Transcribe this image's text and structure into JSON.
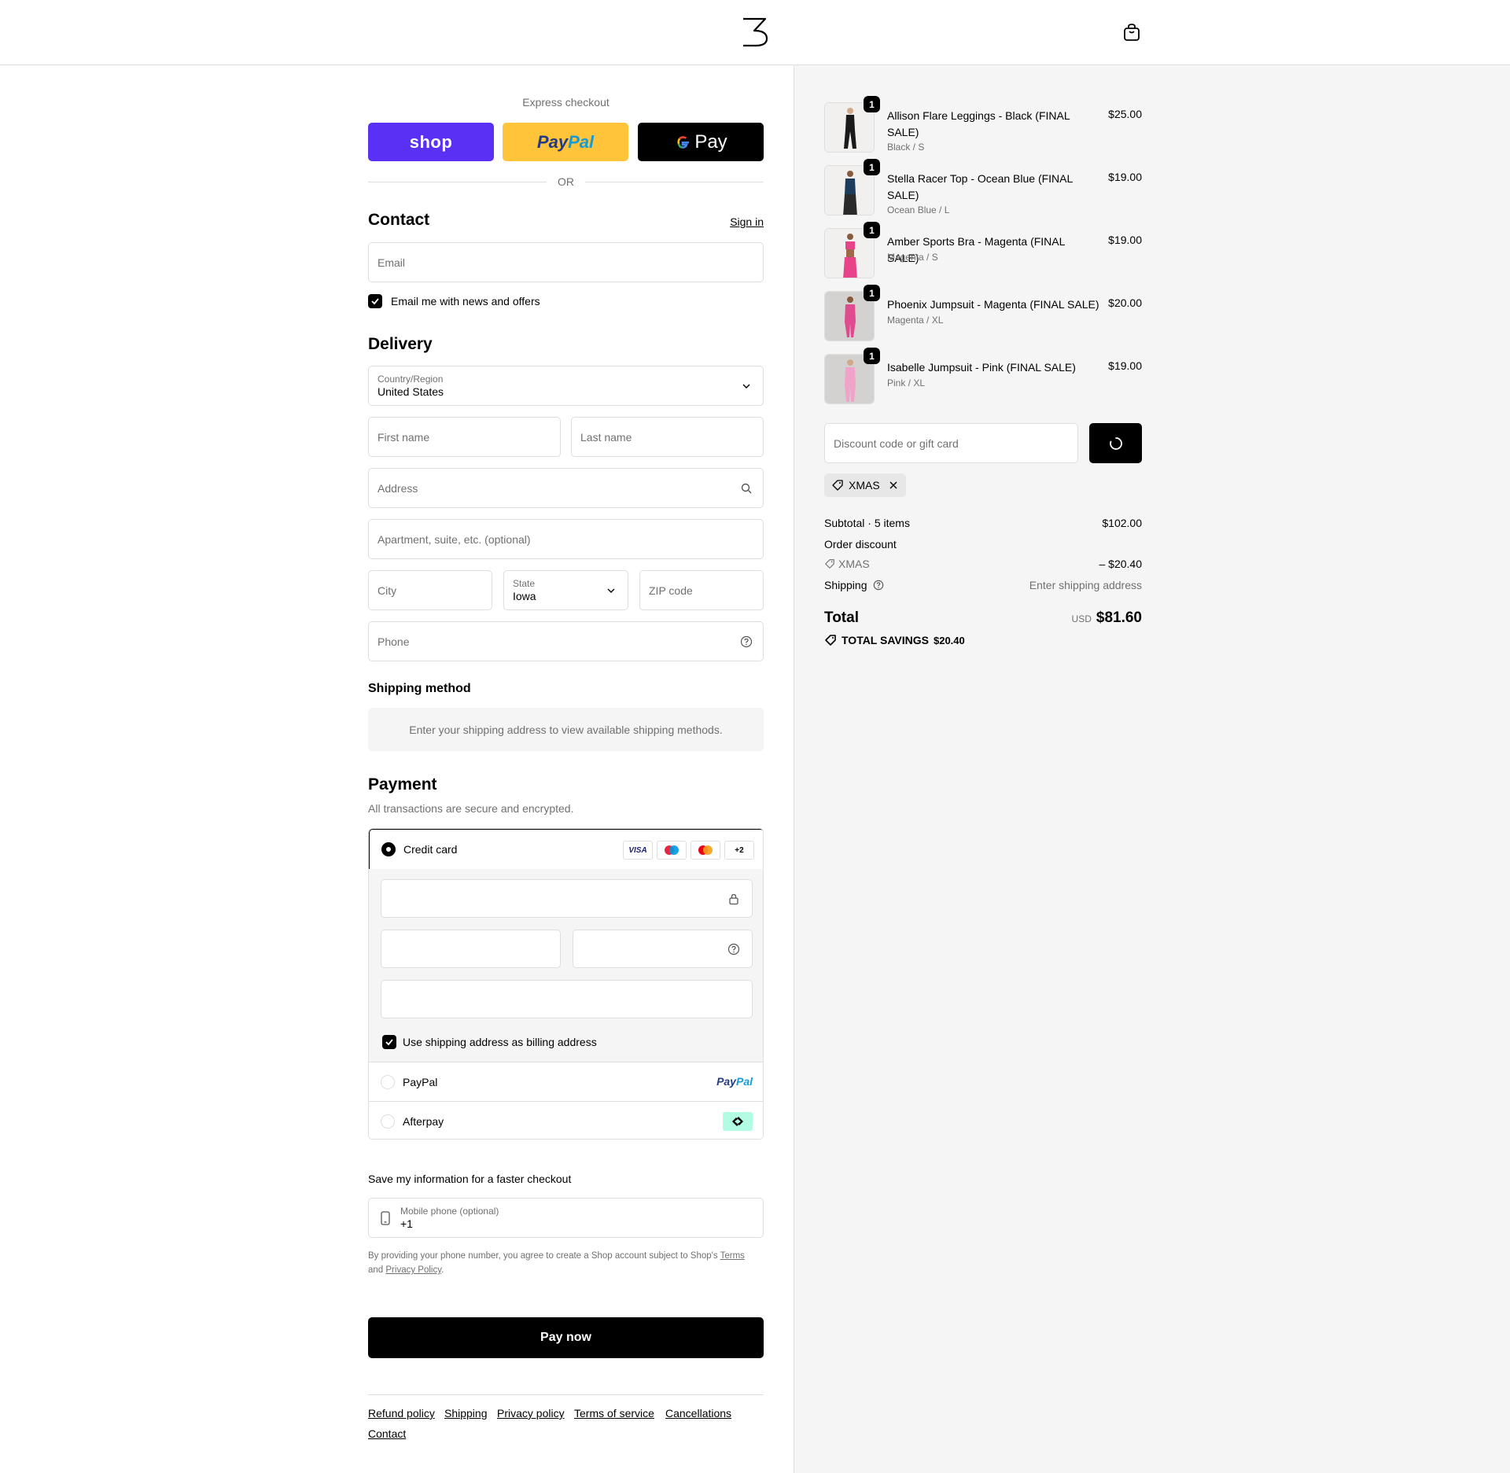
{
  "header": {
    "logo_alt": "logo",
    "cart_icon": "shopping-bag-icon"
  },
  "express": {
    "title": "Express checkout",
    "shop_label": "shop",
    "paypal_label_1": "Pay",
    "paypal_label_2": "Pal",
    "gpay_label": "Pay",
    "or": "OR"
  },
  "contact": {
    "title": "Contact",
    "signin": "Sign in",
    "email_placeholder": "Email",
    "news_label": "Email me with news and offers",
    "news_checked": true
  },
  "delivery": {
    "title": "Delivery",
    "country_label": "Country/Region",
    "country_value": "United States",
    "first_name_placeholder": "First name",
    "last_name_placeholder": "Last name",
    "address_placeholder": "Address",
    "apartment_placeholder": "Apartment, suite, etc. (optional)",
    "city_placeholder": "City",
    "state_label": "State",
    "state_value": "Iowa",
    "zip_placeholder": "ZIP code",
    "phone_placeholder": "Phone"
  },
  "shipping_method": {
    "title": "Shipping method",
    "note": "Enter your shipping address to view available shipping methods."
  },
  "payment": {
    "title": "Payment",
    "subtitle": "All transactions are secure and encrypted.",
    "credit_card_label": "Credit card",
    "card_badges": [
      "VISA",
      "maestro",
      "mastercard",
      "+2"
    ],
    "billing_label": "Use shipping address as billing address",
    "billing_checked": true,
    "paypal_label": "PayPal",
    "paypal_logo_1": "Pay",
    "paypal_logo_2": "Pal",
    "afterpay_label": "Afterpay"
  },
  "save_info": {
    "title": "Save my information for a faster checkout",
    "mobile_label": "Mobile phone (optional)",
    "mobile_value": "+1",
    "legal_text": "By providing your phone number, you agree to create a Shop account subject to Shop's",
    "terms": "Terms",
    "and": "and",
    "privacy": "Privacy Policy",
    "period": "."
  },
  "pay_now": "Pay now",
  "footer": {
    "links": [
      "Refund policy",
      "Shipping",
      "Privacy policy",
      "Terms of service",
      "Cancellations",
      "Contact"
    ]
  },
  "cart": {
    "items": [
      {
        "name": "Allison Flare Leggings - Black (FINAL SALE)",
        "variant": "Black / S",
        "price": "$25.00",
        "qty": "1",
        "color": "#1a1a1a"
      },
      {
        "name": "Stella Racer Top - Ocean Blue (FINAL SALE)",
        "variant": "Ocean Blue / L",
        "price": "$19.00",
        "qty": "1",
        "color": "#1d3b5c"
      },
      {
        "name": "Amber Sports Bra - Magenta (FINAL SALE)",
        "variant": "Magenta / S",
        "price": "$19.00",
        "qty": "1",
        "color": "#e8438a"
      },
      {
        "name": "Phoenix Jumpsuit - Magenta (FINAL SALE)",
        "variant": "Magenta / XL",
        "price": "$20.00",
        "qty": "1",
        "color": "#e04a8e"
      },
      {
        "name": "Isabelle Jumpsuit - Pink (FINAL SALE)",
        "variant": "Pink / XL",
        "price": "$19.00",
        "qty": "1",
        "color": "#f0a3c8"
      }
    ],
    "discount_placeholder": "Discount code or gift card",
    "applied_code": "XMAS",
    "subtotal_label": "Subtotal · 5 items",
    "subtotal_value": "$102.00",
    "order_discount_label": "Order discount",
    "discount_code": "XMAS",
    "discount_value": "– $20.40",
    "shipping_label": "Shipping",
    "shipping_value": "Enter shipping address",
    "total_label": "Total",
    "currency": "USD",
    "total_value": "$81.60",
    "savings_label": "TOTAL SAVINGS",
    "savings_value": "$20.40"
  }
}
